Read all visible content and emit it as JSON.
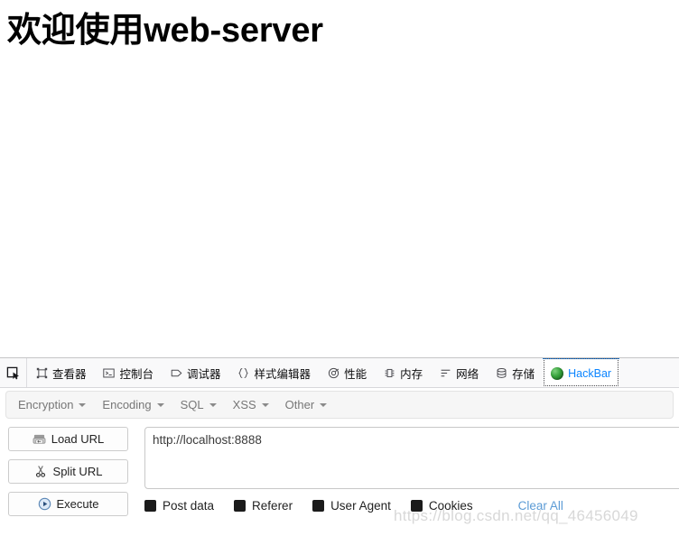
{
  "page": {
    "heading": "欢迎使用web-server"
  },
  "devtools": {
    "picker_icon": "element-picker-icon",
    "tabs": [
      {
        "label": "查看器",
        "icon": "inspector-icon",
        "selected": false
      },
      {
        "label": "控制台",
        "icon": "console-icon",
        "selected": false
      },
      {
        "label": "调试器",
        "icon": "debugger-icon",
        "selected": false
      },
      {
        "label": "样式编辑器",
        "icon": "style-editor-icon",
        "selected": false
      },
      {
        "label": "性能",
        "icon": "performance-icon",
        "selected": false
      },
      {
        "label": "内存",
        "icon": "memory-icon",
        "selected": false
      },
      {
        "label": "网络",
        "icon": "network-icon",
        "selected": false
      },
      {
        "label": "存储",
        "icon": "storage-icon",
        "selected": false
      },
      {
        "label": "HackBar",
        "icon": "hackbar-favicon",
        "selected": true
      }
    ],
    "selected_tab_color": "#0a84ff"
  },
  "hackbar": {
    "menu": [
      {
        "label": "Encryption"
      },
      {
        "label": "Encoding"
      },
      {
        "label": "SQL"
      },
      {
        "label": "XSS"
      },
      {
        "label": "Other"
      }
    ],
    "buttons": [
      {
        "label": "Load URL",
        "icon": "load-url-icon"
      },
      {
        "label": "Split URL",
        "icon": "scissors-icon"
      },
      {
        "label": "Execute",
        "icon": "play-circle-icon"
      }
    ],
    "url_field": {
      "value": "http://localhost:8888",
      "placeholder": "http://"
    },
    "checkboxes": [
      {
        "label": "Post data",
        "checked": true
      },
      {
        "label": "Referer",
        "checked": true
      },
      {
        "label": "User Agent",
        "checked": true
      },
      {
        "label": "Cookies",
        "checked": true
      }
    ],
    "clear_all_label": "Clear All",
    "clear_all_color": "#5b9bd5"
  },
  "watermark": {
    "text": "https://blog.csdn.net/qq_46456049"
  }
}
